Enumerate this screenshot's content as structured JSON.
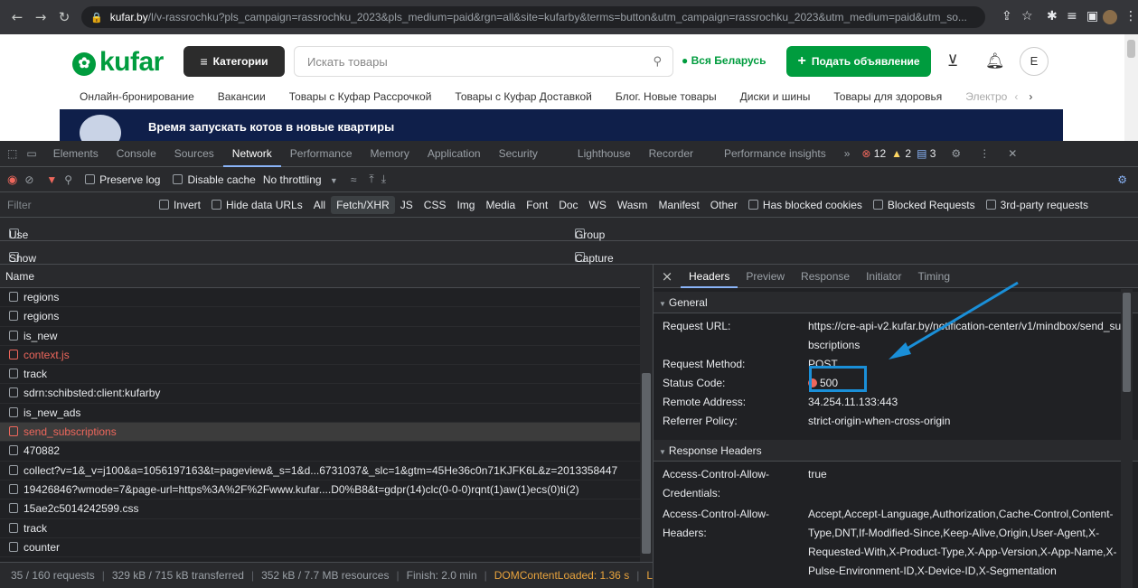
{
  "browser": {
    "url_host": "kufar.by",
    "url_rest": "/l/v-rassrochku?pls_campaign=rassrochku_2023&pls_medium=paid&rgn=all&site=kufarby&terms=button&utm_campaign=rassrochku_2023&utm_medium=paid&utm_so...",
    "profile_initial": "E"
  },
  "site": {
    "logo": "kufar",
    "categories_btn": "Категории",
    "search_placeholder": "Искать товары",
    "region": "Вся Беларусь",
    "post_btn": "Подать объявление",
    "avatar": "E",
    "nav": [
      "Онлайн-бронирование",
      "Вакансии",
      "Товары с Куфар Рассрочкой",
      "Товары с Куфар Доставкой",
      "Блог. Новые товары",
      "Диски и шины",
      "Товары для здоровья",
      "Электро"
    ],
    "banner_text": "Время запускать котов в новые квартиры"
  },
  "devtools": {
    "tabs": [
      "Elements",
      "Console",
      "Sources",
      "Network",
      "Performance",
      "Memory",
      "Application",
      "Security",
      "Lighthouse",
      "Recorder",
      "Performance insights"
    ],
    "active_tab": "Network",
    "errors": "12",
    "warnings": "2",
    "messages": "3",
    "toolbar": {
      "preserve_log": "Preserve log",
      "disable_cache": "Disable cache",
      "throttling": "No throttling"
    },
    "filter": {
      "placeholder": "Filter",
      "invert": "Invert",
      "hide_data_urls": "Hide data URLs",
      "types": [
        "All",
        "Fetch/XHR",
        "JS",
        "CSS",
        "Img",
        "Media",
        "Font",
        "Doc",
        "WS",
        "Wasm",
        "Manifest",
        "Other"
      ],
      "selected_type": "Fetch/XHR",
      "has_blocked_cookies": "Has blocked cookies",
      "blocked_requests": "Blocked Requests",
      "third_party": "3rd-party requests"
    },
    "options": {
      "large_rows": "Use large request rows",
      "group_by_frame": "Group by frame",
      "show_overview": "Show overview",
      "capture_screenshots": "Capture screenshots"
    },
    "list_header": "Name",
    "requests": [
      {
        "name": "regions",
        "error": false
      },
      {
        "name": "regions",
        "error": false
      },
      {
        "name": "is_new",
        "error": false
      },
      {
        "name": "context.js",
        "error": true
      },
      {
        "name": "track",
        "error": false
      },
      {
        "name": "sdrn:schibsted:client:kufarby",
        "error": false
      },
      {
        "name": "is_new_ads",
        "error": false
      },
      {
        "name": "send_subscriptions",
        "error": true,
        "selected": true
      },
      {
        "name": "470882",
        "error": false
      },
      {
        "name": "collect?v=1&_v=j100&a=1056197163&t=pageview&_s=1&d...6731037&_slc=1&gtm=45He36c0n71KJFK6L&z=2013358447",
        "error": false
      },
      {
        "name": "19426846?wmode=7&page-url=https%3A%2F%2Fwww.kufar....D0%B8&t=gdpr(14)clc(0-0-0)rqnt(1)aw(1)ecs(0)ti(2)",
        "error": false
      },
      {
        "name": "15ae2c5014242599.css",
        "error": false
      },
      {
        "name": "track",
        "error": false
      },
      {
        "name": "counter",
        "error": false
      }
    ],
    "status": {
      "requests": "35 / 160 requests",
      "transferred": "329 kB / 715 kB transferred",
      "resources": "352 kB / 7.7 MB resources",
      "finish": "Finish: 2.0 min",
      "dcl": "DOMContentLoaded: 1.36 s",
      "load": "L"
    },
    "details": {
      "tabs": [
        "Headers",
        "Preview",
        "Response",
        "Initiator",
        "Timing"
      ],
      "active": "Headers",
      "general_title": "General",
      "general": [
        {
          "k": "Request URL:",
          "v": "https://cre-api-v2.kufar.by/notification-center/v1/mindbox/send_subscriptions"
        },
        {
          "k": "Request Method:",
          "v": "POST"
        },
        {
          "k": "Status Code:",
          "v": "500"
        },
        {
          "k": "Remote Address:",
          "v": "34.254.11.133:443"
        },
        {
          "k": "Referrer Policy:",
          "v": "strict-origin-when-cross-origin"
        }
      ],
      "response_title": "Response Headers",
      "response": [
        {
          "k": "Access-Control-Allow-Credentials:",
          "v": "true"
        },
        {
          "k": "Access-Control-Allow-Headers:",
          "v": "Accept,Accept-Language,Authorization,Cache-Control,Content-Type,DNT,If-Modified-Since,Keep-Alive,Origin,User-Agent,X-Requested-With,X-Product-Type,X-App-Version,X-App-Name,X-Pulse-Environment-ID,X-Device-ID,X-Segmentation"
        }
      ]
    }
  },
  "colors": {
    "accent": "#009c3e",
    "highlight": "#1a8fd8",
    "error": "#ee675c"
  }
}
